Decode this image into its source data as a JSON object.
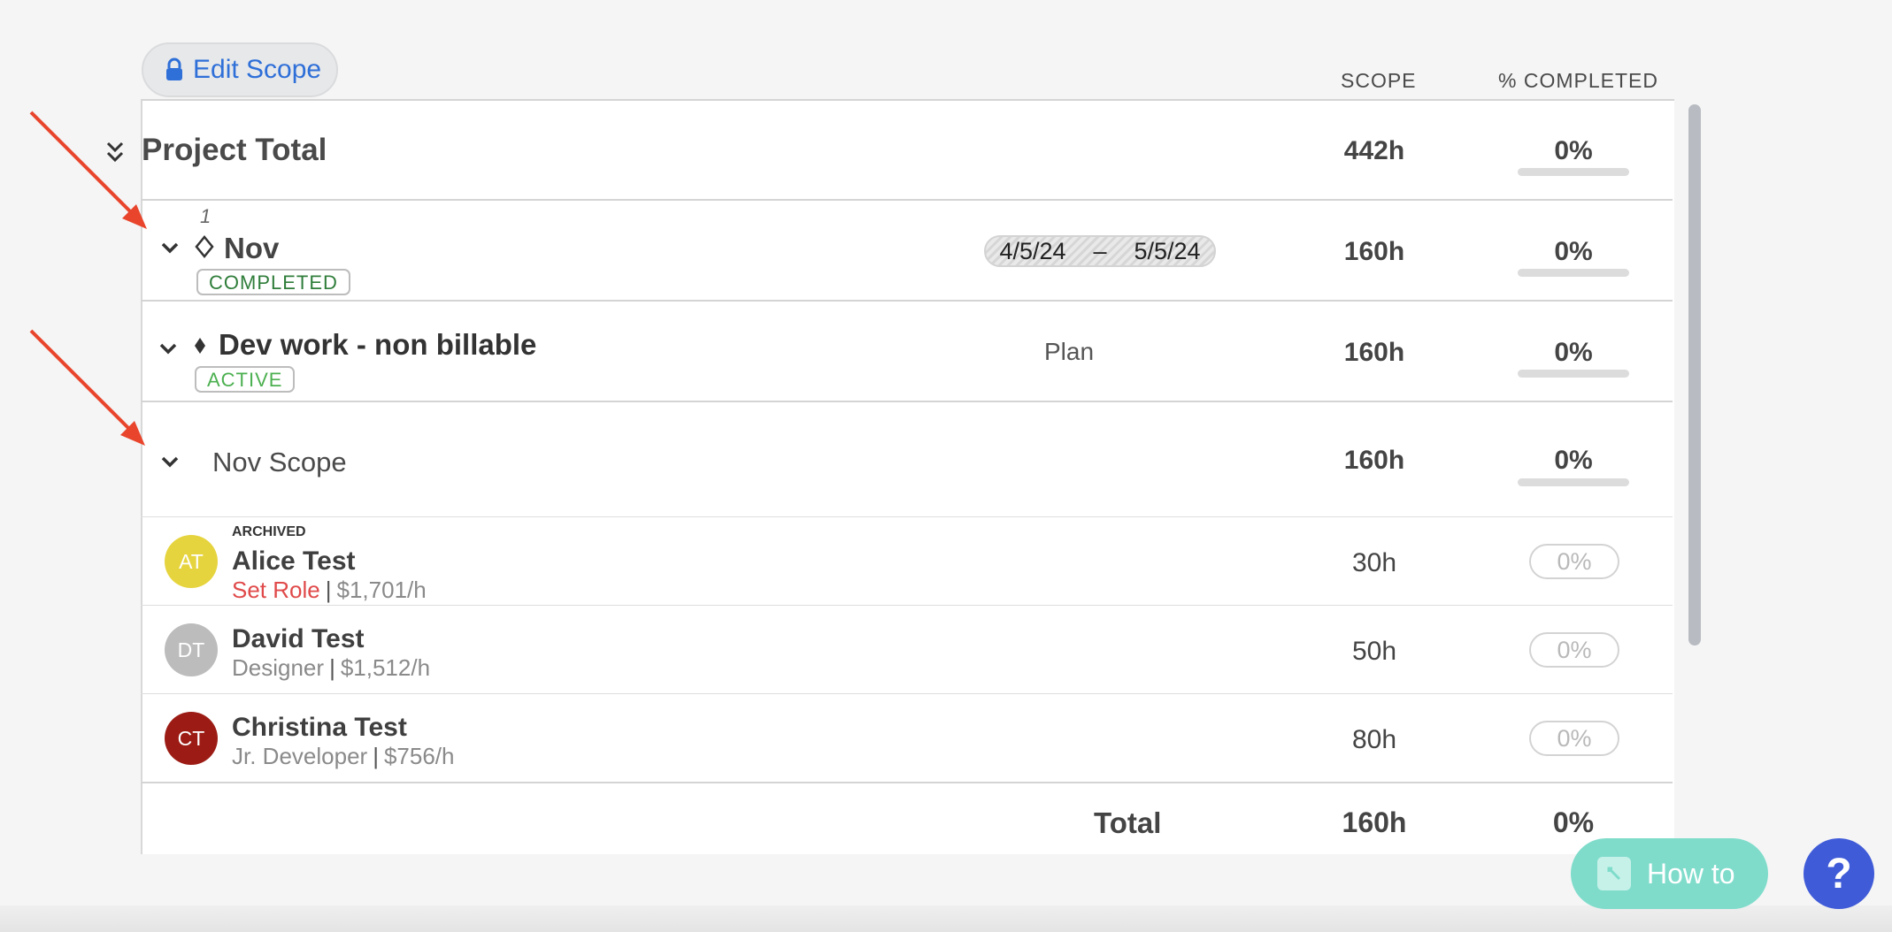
{
  "toolbar": {
    "edit_scope_label": "Edit Scope"
  },
  "columns": {
    "scope": "SCOPE",
    "completed": "% COMPLETED"
  },
  "project_total": {
    "label": "Project Total",
    "scope": "442h",
    "completed": "0%",
    "completed_fraction": 0
  },
  "phase": {
    "number": "1",
    "name": "Nov",
    "status": "COMPLETED",
    "start_date": "4/5/24",
    "date_separator": "–",
    "end_date": "5/5/24",
    "scope": "160h",
    "completed": "0%"
  },
  "work_category": {
    "name": "Dev work - non billable",
    "status": "ACTIVE",
    "plan_label": "Plan",
    "scope": "160h",
    "completed": "0%"
  },
  "scope_group": {
    "name": "Nov Scope",
    "scope": "160h",
    "completed": "0%"
  },
  "members": [
    {
      "initials": "AT",
      "tag": "ARCHIVED",
      "name": "Alice Test",
      "role": "Set Role",
      "rate": "$1,701/h",
      "scope": "30h",
      "completed": "0%",
      "color": "#e6d43f",
      "role_color": "#e04a4a"
    },
    {
      "initials": "DT",
      "tag": "",
      "name": "David Test",
      "role": "Designer",
      "rate": "$1,512/h",
      "scope": "50h",
      "completed": "0%",
      "color": "#bcbcbc",
      "role_color": "#8a8a8a"
    },
    {
      "initials": "CT",
      "tag": "",
      "name": "Christina Test",
      "role": "Jr. Developer",
      "rate": "$756/h",
      "scope": "80h",
      "completed": "0%",
      "color": "#9c1c15",
      "role_color": "#8a8a8a"
    }
  ],
  "footer": {
    "total_label": "Total",
    "scope": "160h",
    "completed": "0%"
  },
  "widgets": {
    "how_to_label": "How to",
    "help_label": "?"
  },
  "colors": {
    "accent": "#2e6fd8",
    "arrow": "#e8452c",
    "how_to": "#7fdccb",
    "help": "#3f5bd8"
  }
}
